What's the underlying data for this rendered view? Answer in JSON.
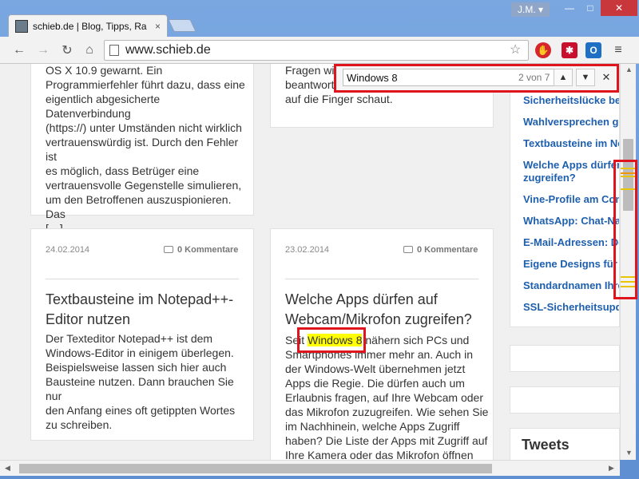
{
  "browser": {
    "tab_title": "schieb.de | Blog, Tipps, Ra",
    "tab_close": "×",
    "user_name": "J.M. ▾",
    "window_buttons": {
      "minimize": "—",
      "maximize": "□",
      "close": "✕"
    },
    "url": "www.schieb.de",
    "nav": {
      "back": "←",
      "forward": "→",
      "reload": "↻",
      "home": "⌂"
    },
    "star": "☆",
    "menu": "≡"
  },
  "find_bar": {
    "query": "Windows 8",
    "count": "2 von 7",
    "prev": "▲",
    "next": "▼",
    "close": "✕"
  },
  "cards": {
    "top_left_lines": [
      "OS X 10.9 gewarnt. Ein",
      "Programmierfehler führt dazu, dass eine",
      "eigentlich abgesicherte Datenverbindung",
      "(https://) unter Umständen nicht wirklich",
      "vertrauenswürdig ist. Durch den Fehler ist",
      "es möglich, dass Betrüger eine",
      "vertrauensvolle Gegenstelle simulieren,",
      "um den Betroffenen auszuspionieren. Das",
      "[…]"
    ],
    "top_right_lines": [
      "Fragen will",
      "beantworte",
      "auf die Finger schaut."
    ],
    "post1": {
      "date": "24.02.2014",
      "comments": "0 Kommentare",
      "title": "Textbausteine im Notepad++-Editor nutzen",
      "lines": [
        "Der Texteditor Notepad++ ist dem",
        "Windows-Editor in einigem überlegen.",
        "Beispielsweise lassen sich hier auch",
        "Bausteine nutzen. Dann brauchen Sie nur",
        "den Anfang eines oft getippten Wortes",
        "zu schreiben."
      ]
    },
    "post2": {
      "date": "23.02.2014",
      "comments": "0 Kommentare",
      "title": "Welche Apps dürfen auf Webcam/Mikrofon zugreifen?",
      "line1_before": "Seit ",
      "line1_highlight": "Windows 8",
      "line1_after": " nähern sich PCs und",
      "lines": [
        "Smartphones immer mehr an. Auch in",
        "der Windows-Welt übernehmen jetzt",
        "Apps die Regie. Die dürfen auch um",
        "Erlaubnis fragen, auf Ihre Webcam oder",
        "das Mikrofon zuzugreifen. Wie sehen Sie",
        "im Nachhinein, welche Apps Zugriff",
        "haben? Die Liste der Apps mit Zugriff auf",
        "Ihre Kamera oder das Mikrofon öffnen"
      ]
    }
  },
  "sidebar": {
    "links": [
      "Sicherheitslücke bei",
      "Wahlversprechen ge",
      "Textbausteine im Ne",
      "Welche Apps dürfen",
      "zugreifen?",
      "Vine-Profile am Com",
      "WhatsApp: Chat-Na",
      "E-Mail-Adressen: De",
      "Eigene Designs für W",
      "Standardnamen Ihre",
      "SSL-Sicherheitsupda"
    ],
    "tweets_title": "Tweets"
  },
  "colors": {
    "link": "#1e5fae",
    "highlight": "#ffff00",
    "annotation": "#e0141c",
    "window_accent": "#5d8fd2"
  }
}
